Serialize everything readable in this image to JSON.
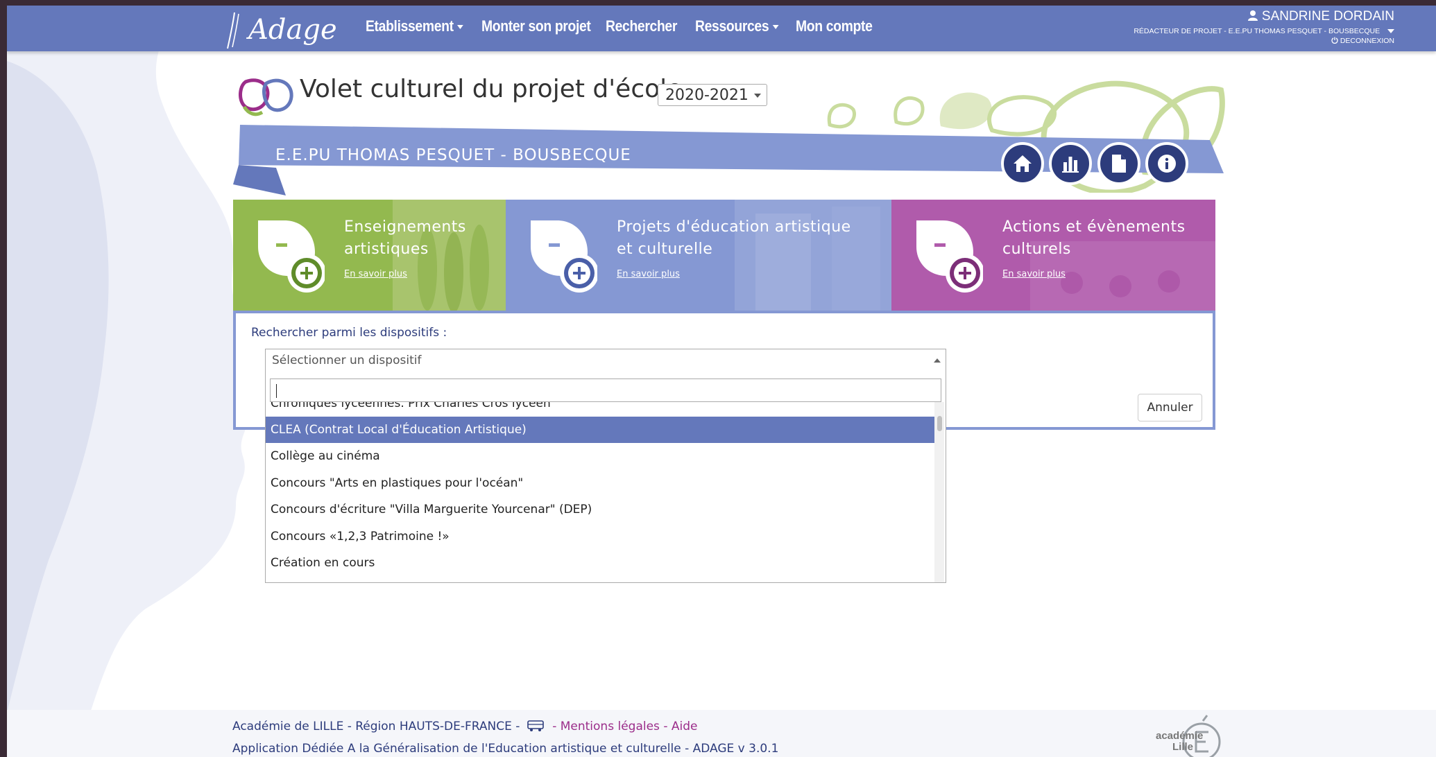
{
  "navbar": {
    "items": [
      "Etablissement",
      "Monter son projet",
      "Rechercher",
      "Ressources",
      "Mon compte"
    ],
    "user_name": "SANDRINE DORDAIN",
    "user_role": "RÉDACTEUR DE PROJET - E.E.PU THOMAS PESQUET - BOUSBECQUE",
    "logout": "DECONNEXION"
  },
  "header": {
    "title": "Volet culturel du projet d'école",
    "year": "2020-2021",
    "school": "E.E.PU THOMAS PESQUET - BOUSBECQUE",
    "buttons": [
      "home-icon",
      "bar-chart-icon",
      "document-icon",
      "info-icon"
    ]
  },
  "tiles": [
    {
      "line1": "Enseignements",
      "line2": "artistiques",
      "link": "En savoir plus",
      "color": "#93b94f"
    },
    {
      "line1": "Projets d'éducation artistique",
      "line2": "et culturelle",
      "link": "En savoir plus",
      "color": "#8598d3"
    },
    {
      "line1": "Actions et évènements",
      "line2": "culturels",
      "link": "En savoir plus",
      "color": "#b05bab"
    }
  ],
  "search": {
    "label": "Rechercher parmi les dispositifs :",
    "placeholder": "Sélectionner un dispositif",
    "search_value": "",
    "options": [
      "Chroniques lycéennes. Prix Charles Cros lycéen",
      "CLEA (Contrat Local d'Éducation Artistique)",
      "Collège au cinéma",
      "Concours \"Arts en plastiques pour l'océan\"",
      "Concours d'écriture \"Villa Marguerite Yourcenar\" (DEP)",
      "Concours «1,2,3 Patrimoine !»",
      "Création en cours"
    ],
    "selected_option": "CLEA (Contrat Local d'Éducation Artistique)",
    "cancel": "Annuler"
  },
  "footer": {
    "line1_prefix": "Académie de LILLE - Région HAUTS-DE-FRANCE -",
    "legal": "- Mentions légales",
    "help": "- Aide",
    "line2": "Application Dédiée A la Généralisation de l'Education artistique et culturelle - ADAGE v 3.0.1"
  },
  "colors": {
    "navbar": "#6478bb",
    "ribbon": "#8598d3",
    "round_buttons": "#2d3c7c",
    "selection": "#6478bb",
    "link_purple": "#9b2d8a"
  }
}
